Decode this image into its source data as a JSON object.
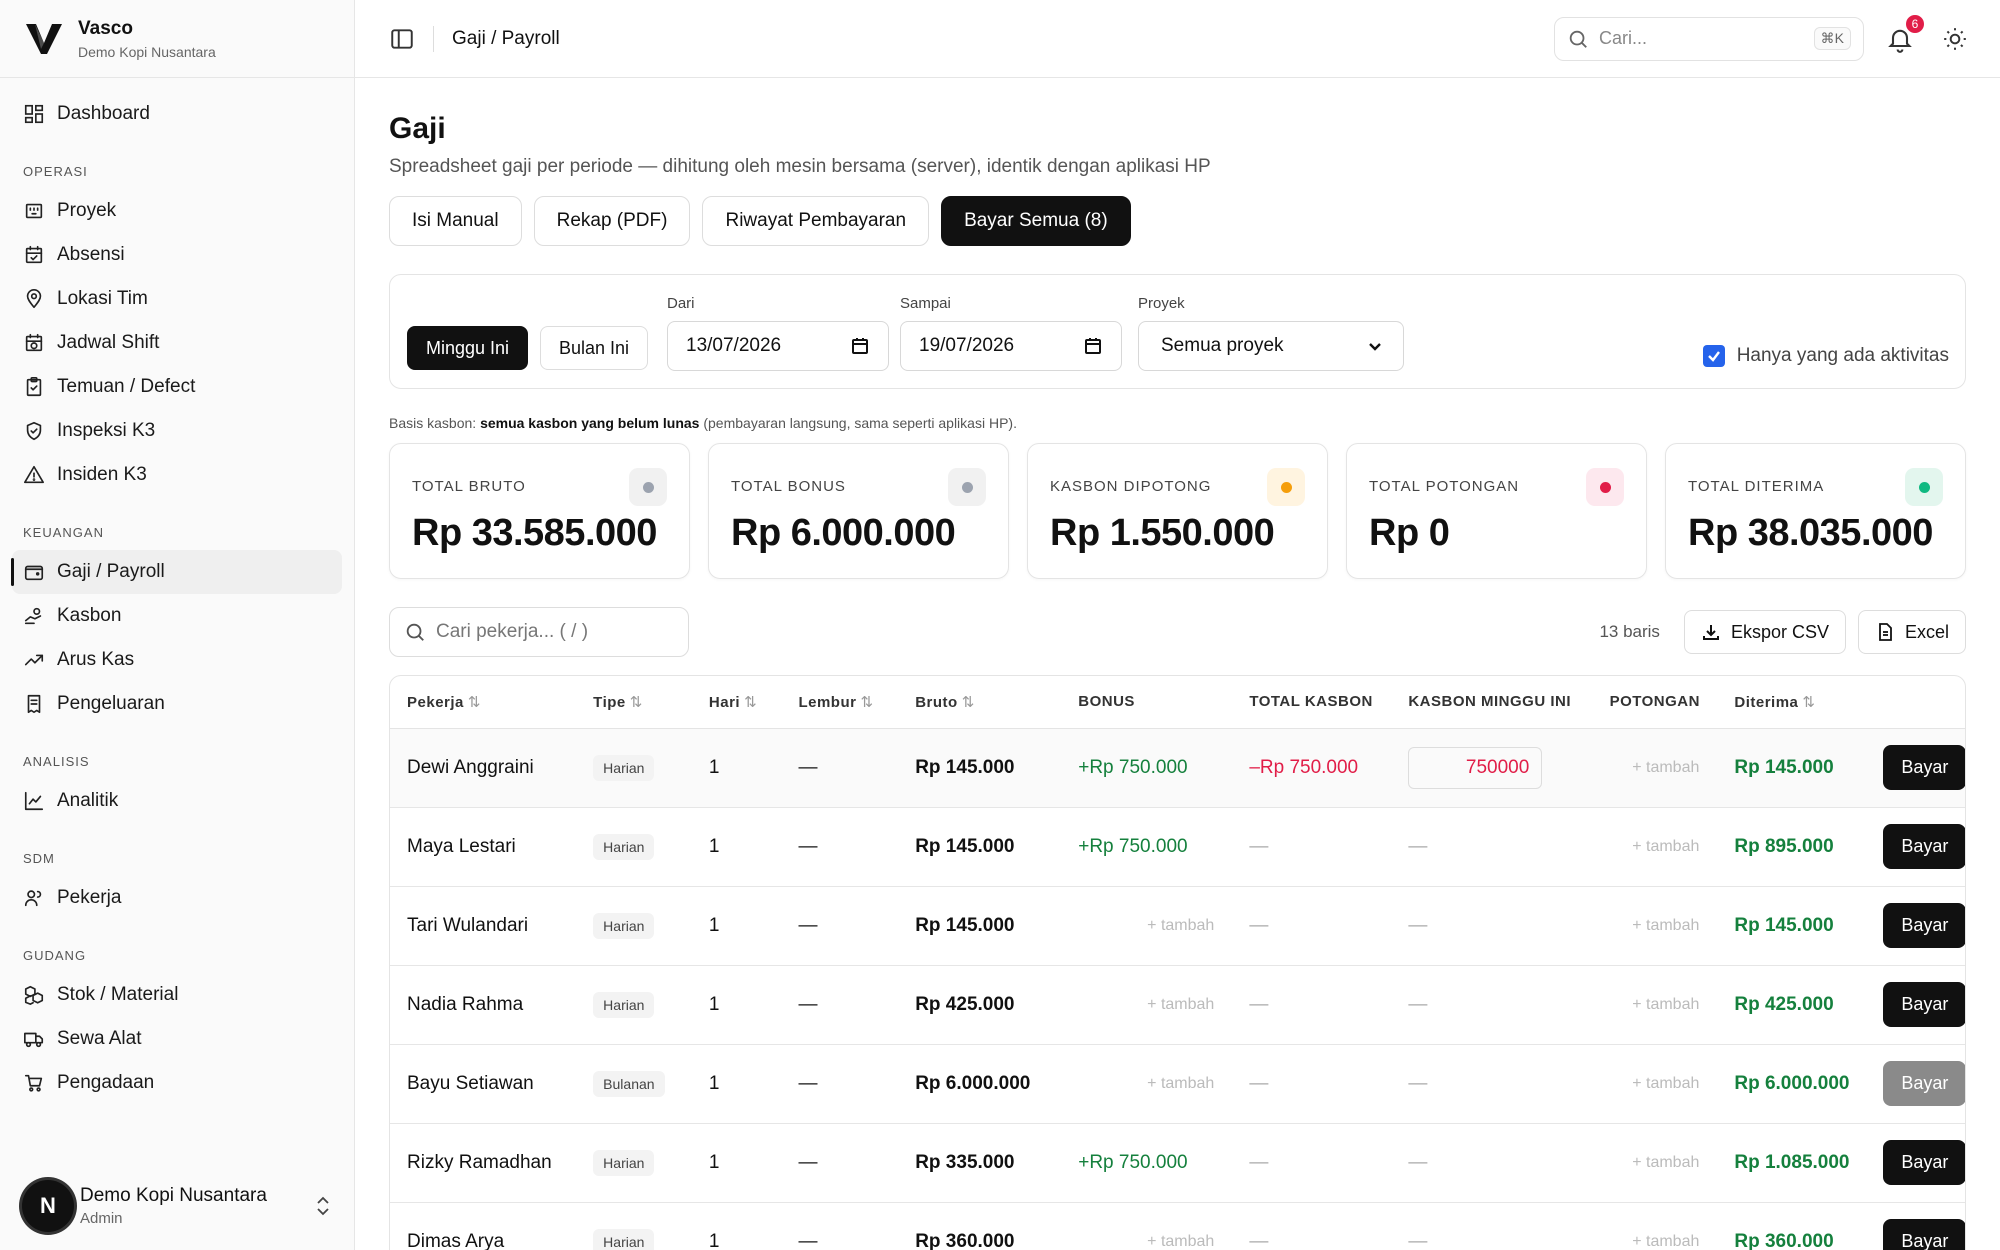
{
  "brand": {
    "name": "Vasco",
    "sub": "Demo Kopi Nusantara"
  },
  "sidebar": {
    "dashboard": "Dashboard",
    "sections": [
      {
        "title": "OPERASI",
        "items": [
          {
            "label": "Proyek",
            "icon": "building-icon"
          },
          {
            "label": "Absensi",
            "icon": "calendar-check-icon"
          },
          {
            "label": "Lokasi Tim",
            "icon": "map-pin-icon"
          },
          {
            "label": "Jadwal Shift",
            "icon": "calendar-clock-icon"
          },
          {
            "label": "Temuan / Defect",
            "icon": "clipboard-icon"
          },
          {
            "label": "Inspeksi K3",
            "icon": "shield-icon"
          },
          {
            "label": "Insiden K3",
            "icon": "warning-icon"
          }
        ]
      },
      {
        "title": "KEUANGAN",
        "items": [
          {
            "label": "Gaji / Payroll",
            "icon": "wallet-icon",
            "active": true
          },
          {
            "label": "Kasbon",
            "icon": "hand-coins-icon"
          },
          {
            "label": "Arus Kas",
            "icon": "trending-icon"
          },
          {
            "label": "Pengeluaran",
            "icon": "receipt-icon"
          }
        ]
      },
      {
        "title": "ANALISIS",
        "items": [
          {
            "label": "Analitik",
            "icon": "chart-line-icon"
          }
        ]
      },
      {
        "title": "SDM",
        "items": [
          {
            "label": "Pekerja",
            "icon": "users-icon"
          }
        ]
      },
      {
        "title": "GUDANG",
        "items": [
          {
            "label": "Stok / Material",
            "icon": "boxes-icon"
          },
          {
            "label": "Sewa Alat",
            "icon": "truck-icon"
          },
          {
            "label": "Pengadaan",
            "icon": "cart-icon"
          }
        ]
      }
    ],
    "footer": {
      "avatar": "N",
      "name": "Demo Kopi Nusantara",
      "role": "Admin"
    }
  },
  "topbar": {
    "breadcrumb": "Gaji / Payroll",
    "search_placeholder": "Cari...",
    "shortcut": "⌘K",
    "notif_count": "6"
  },
  "page": {
    "title": "Gaji",
    "subtitle": "Spreadsheet gaji per periode — dihitung oleh mesin bersama (server), identik dengan aplikasi HP",
    "actions": [
      "Isi Manual",
      "Rekap (PDF)",
      "Riwayat Pembayaran",
      "Bayar Semua (8)"
    ]
  },
  "filters": {
    "week": "Minggu Ini",
    "month": "Bulan Ini",
    "from_label": "Dari",
    "from_value": "13/07/2026",
    "to_label": "Sampai",
    "to_value": "19/07/2026",
    "project_label": "Proyek",
    "project_value": "Semua proyek",
    "activity_only": "Hanya yang ada aktivitas"
  },
  "basis": {
    "prefix": "Basis kasbon:",
    "bold": "semua kasbon yang belum lunas",
    "suffix": "(pembayaran langsung, sama seperti aplikasi HP)."
  },
  "stats": [
    {
      "label": "TOTAL BRUTO",
      "value": "Rp 33.585.000",
      "dot": "#9ca3af",
      "bg": "#f1f1f1"
    },
    {
      "label": "TOTAL BONUS",
      "value": "Rp 6.000.000",
      "dot": "#9ca3af",
      "bg": "#f1f1f1"
    },
    {
      "label": "KASBON DIPOTONG",
      "value": "Rp 1.550.000",
      "dot": "#f59e0b",
      "bg": "#fff4e0"
    },
    {
      "label": "TOTAL POTONGAN",
      "value": "Rp 0",
      "dot": "#e11d48",
      "bg": "#fde8ee"
    },
    {
      "label": "TOTAL DITERIMA",
      "value": "Rp 38.035.000",
      "dot": "#10b981",
      "bg": "#e3f6ee"
    }
  ],
  "table_tools": {
    "search_placeholder": "Cari pekerja...  ( / )",
    "rows": "13 baris",
    "export_csv": "Ekspor CSV",
    "excel": "Excel"
  },
  "table": {
    "headers": [
      "Pekerja",
      "Tipe",
      "Hari",
      "Lembur",
      "Bruto",
      "BONUS",
      "TOTAL KASBON",
      "KASBON MINGGU INI",
      "POTONGAN",
      "Diterima"
    ],
    "add_label": "+ tambah",
    "pay_label": "Bayar",
    "rows": [
      {
        "name": "Dewi Anggraini",
        "type": "Harian",
        "days": "1",
        "ot": "—",
        "bruto": "Rp 145.000",
        "bonus": "+Rp 750.000",
        "kasbon": "–Rp 750.000",
        "kasbon_week": "750000",
        "received": "Rp 145.000",
        "highlight": true
      },
      {
        "name": "Maya Lestari",
        "type": "Harian",
        "days": "1",
        "ot": "—",
        "bruto": "Rp 145.000",
        "bonus": "+Rp 750.000",
        "kasbon": "—",
        "kasbon_week": "—",
        "received": "Rp 895.000"
      },
      {
        "name": "Tari Wulandari",
        "type": "Harian",
        "days": "1",
        "ot": "—",
        "bruto": "Rp 145.000",
        "bonus": "",
        "kasbon": "—",
        "kasbon_week": "—",
        "received": "Rp 145.000"
      },
      {
        "name": "Nadia Rahma",
        "type": "Harian",
        "days": "1",
        "ot": "—",
        "bruto": "Rp 425.000",
        "bonus": "",
        "kasbon": "—",
        "kasbon_week": "—",
        "received": "Rp 425.000"
      },
      {
        "name": "Bayu Setiawan",
        "type": "Bulanan",
        "days": "1",
        "ot": "—",
        "bruto": "Rp 6.000.000",
        "bonus": "",
        "kasbon": "—",
        "kasbon_week": "—",
        "received": "Rp 6.000.000",
        "disabled": true
      },
      {
        "name": "Rizky Ramadhan",
        "type": "Harian",
        "days": "1",
        "ot": "—",
        "bruto": "Rp 335.000",
        "bonus": "+Rp 750.000",
        "kasbon": "—",
        "kasbon_week": "—",
        "received": "Rp 1.085.000"
      },
      {
        "name": "Dimas Arya",
        "type": "Harian",
        "days": "1",
        "ot": "—",
        "bruto": "Rp 360.000",
        "bonus": "",
        "kasbon": "—",
        "kasbon_week": "—",
        "received": "Rp 360.000"
      }
    ]
  }
}
